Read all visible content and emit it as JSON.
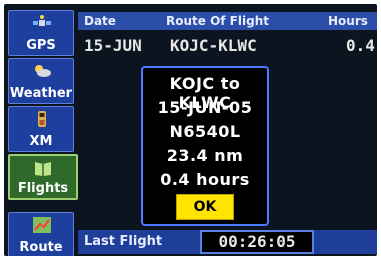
{
  "sidebar": {
    "items": [
      {
        "label": "GPS",
        "icon": "satellite-icon"
      },
      {
        "label": "Weather",
        "icon": "weather-icon"
      },
      {
        "label": "XM",
        "icon": "xm-radio-icon"
      },
      {
        "label": "Flights",
        "icon": "flight-log-icon",
        "active": true
      },
      {
        "label": "Route",
        "icon": "route-icon"
      }
    ]
  },
  "table": {
    "headers": [
      "Date",
      "Route Of Flight",
      "Hours"
    ],
    "rows": [
      {
        "date": "15-JUN",
        "route": "KOJC-KLWC",
        "hours": "0.4"
      }
    ]
  },
  "dialog": {
    "lines": [
      "KOJC to KLWC",
      "15-JUN-05",
      "N6540L",
      "23.4 nm",
      "0.4 hours"
    ],
    "ok_label": "OK"
  },
  "footer": {
    "last_flight_label": "Last Flight",
    "last_flight_time": "00:26:05"
  },
  "colors": {
    "background": "#0c1420",
    "tab": "#1f3f9e",
    "active_tab": "#2f6a2a",
    "dialog_border": "#4f79ff",
    "ok_button": "#ffe400"
  }
}
